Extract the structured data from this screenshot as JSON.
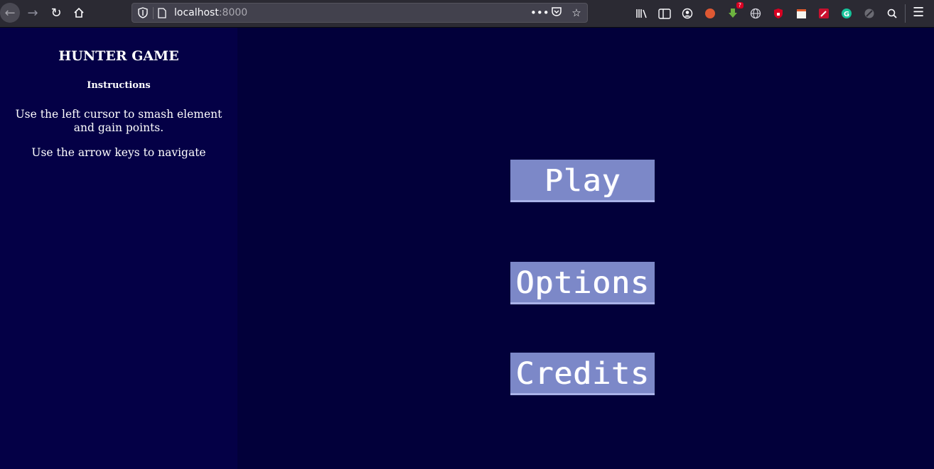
{
  "browser": {
    "url_host": "localhost",
    "url_port": ":8000",
    "download_badge": "?"
  },
  "sidebar": {
    "title": "HUNTER GAME",
    "instructions_heading": "Instructions",
    "instruction_1": "Use the left cursor to smash element and gain points.",
    "instruction_2": "Use the arrow keys to navigate"
  },
  "menu": {
    "play": "Play",
    "options": "Options",
    "credits": "Credits"
  },
  "colors": {
    "page_bg": "#02003a",
    "sidebar_bg": "#040046",
    "button_bg": "#7c88c8"
  }
}
